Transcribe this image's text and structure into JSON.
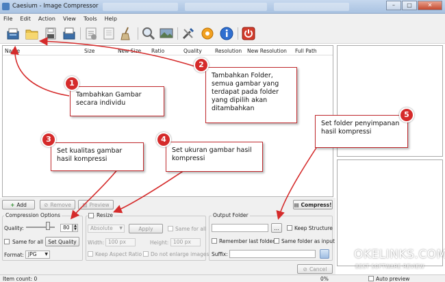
{
  "window": {
    "title": "Caesium - Image Compressor",
    "controls": {
      "minimize": "–",
      "maximize": "□",
      "close": "✕"
    }
  },
  "menu": [
    "File",
    "Edit",
    "Action",
    "View",
    "Tools",
    "Help"
  ],
  "toolbar_icons": [
    "open-file-icon",
    "open-folder-icon",
    "save-icon",
    "save-all-icon",
    "remove-icon",
    "clear-icon",
    "zoom-icon",
    "preview-image-icon",
    "settings-icon",
    "update-icon",
    "info-icon",
    "exit-icon"
  ],
  "columns": [
    "Name",
    "Size",
    "New Size",
    "Ratio",
    "Quality",
    "Resolution",
    "New Resolution",
    "Full Path"
  ],
  "actions": {
    "add": "Add",
    "remove": "Remove",
    "preview": "Preview",
    "compress": "Compress!"
  },
  "compression": {
    "title": "Compression Options",
    "quality_label": "Quality:",
    "quality_value": "80",
    "same_for_all": "Same for all",
    "set_quality": "Set Quality",
    "format_label": "Format:",
    "format_value": "JPG"
  },
  "resize": {
    "title": "Resize",
    "mode": "Absolute",
    "apply": "Apply",
    "same_for_all": "Same for all",
    "width_label": "Width:",
    "width_value": "100 px",
    "height_label": "Height:",
    "height_value": "100 px",
    "keep_aspect": "Keep Aspect Ratio",
    "no_enlarge": "Do not enlarge images"
  },
  "output": {
    "title": "Output Folder",
    "browse": "...",
    "keep_structure": "Keep Structure",
    "remember": "Remember last folder",
    "same_folder": "Same folder as input",
    "suffix_label": "Suffix:"
  },
  "cancel": "Cancel",
  "status": {
    "item_count": "Item count: 0",
    "progress": "0%",
    "auto_preview": "Auto preview"
  },
  "callouts": [
    {
      "num": "1",
      "text": "Tambahkan Gambar secara individu"
    },
    {
      "num": "2",
      "text": "Tambahkan Folder, semua gambar yang terdapat pada folder yang dipilih akan ditambahkan"
    },
    {
      "num": "3",
      "text": "Set kualitas gambar hasil kompressi"
    },
    {
      "num": "4",
      "text": "Set ukuran gambar hasil kompressi"
    },
    {
      "num": "5",
      "text": "Set folder penyimpanan hasil kompressi"
    }
  ],
  "watermark": {
    "name": "OKELINKS.COM",
    "tagline": "BEST SOFTWARE REVIEW"
  },
  "colors": {
    "accent": "#d52b2b",
    "titlebar": "#b7cbe6"
  }
}
